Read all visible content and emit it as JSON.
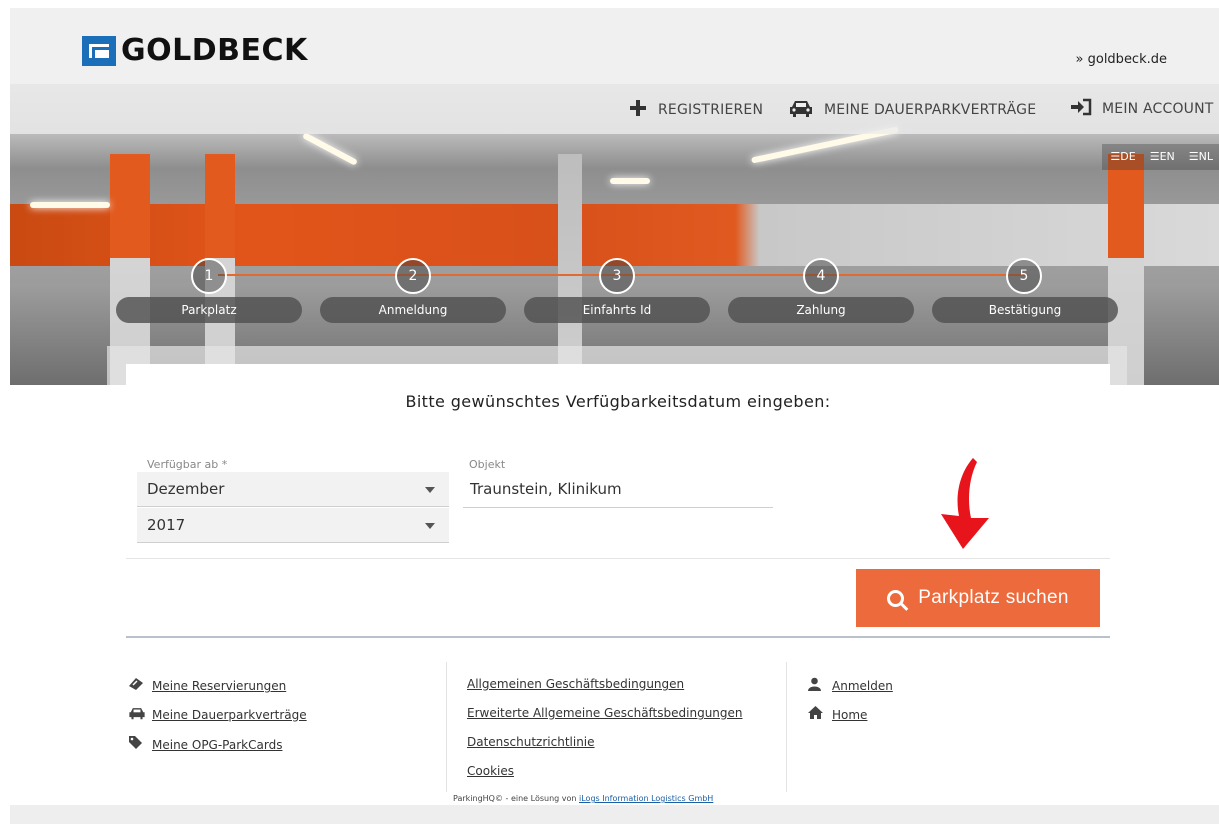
{
  "header": {
    "brand": "GOLDBECK",
    "site_link": "» goldbeck.de"
  },
  "nav": {
    "items": [
      {
        "label": "REGISTRIEREN",
        "icon": "plus-icon"
      },
      {
        "label": "MEINE DAUERPARKVERTRÄGE",
        "icon": "car-icon"
      },
      {
        "label": "MEIN ACCOUNT",
        "icon": "sign-in-icon"
      }
    ]
  },
  "languages": [
    "DE",
    "EN",
    "NL"
  ],
  "steps": [
    {
      "number": "1",
      "label": "Parkplatz"
    },
    {
      "number": "2",
      "label": "Anmeldung"
    },
    {
      "number": "3",
      "label": "Einfahrts Id"
    },
    {
      "number": "4",
      "label": "Zahlung"
    },
    {
      "number": "5",
      "label": "Bestätigung"
    }
  ],
  "form": {
    "title": "Bitte gewünschtes Verfügbarkeitsdatum eingeben:",
    "date_label": "Verfügbar ab *",
    "month_value": "Dezember",
    "year_value": "2017",
    "object_label": "Objekt",
    "object_value": "Traunstein, Klinikum",
    "search_button": "Parkplatz suchen"
  },
  "footer": {
    "col1": [
      {
        "label": "Meine Reservierungen",
        "icon": "ticket-icon"
      },
      {
        "label": "Meine Dauerparkverträge",
        "icon": "car-icon"
      },
      {
        "label": "Meine OPG-ParkCards",
        "icon": "tag-icon"
      }
    ],
    "col2": [
      "Allgemeinen Geschäftsbedingungen",
      "Erweiterte Allgemeine Geschäftsbedingungen",
      "Datenschutzrichtlinie",
      "Cookies"
    ],
    "col3": [
      {
        "label": "Anmelden",
        "icon": "user-icon"
      },
      {
        "label": "Home",
        "icon": "home-icon"
      }
    ],
    "credit_prefix": "ParkingHQ© - eine Lösung von ",
    "credit_link": "iLogs Information Logistics GmbH"
  },
  "colors": {
    "accent": "#ec6a3c",
    "brand_blue": "#1a6fb8",
    "arrow_red": "#e8141c"
  }
}
